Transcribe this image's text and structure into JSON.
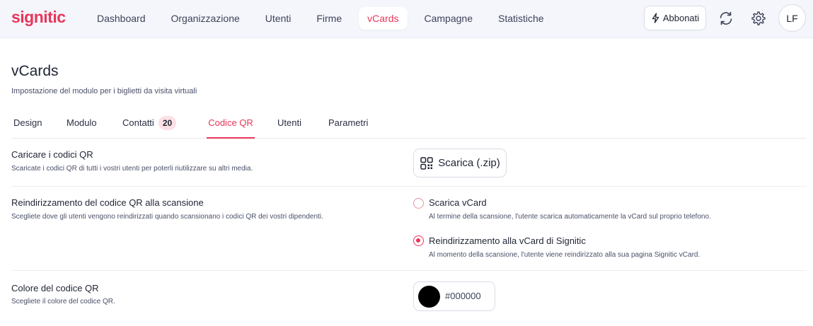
{
  "brand": {
    "name": "signitic",
    "accent": "#e8365a"
  },
  "nav": {
    "items": [
      {
        "label": "Dashboard",
        "active": false
      },
      {
        "label": "Organizzazione",
        "active": false
      },
      {
        "label": "Utenti",
        "active": false
      },
      {
        "label": "Firme",
        "active": false
      },
      {
        "label": "vCards",
        "active": true
      },
      {
        "label": "Campagne",
        "active": false
      },
      {
        "label": "Statistiche",
        "active": false
      }
    ],
    "subscribe_label": "Abbonati",
    "subscribe_icon": "lightning-icon",
    "sync_icon": "sync-icon",
    "settings_icon": "gear-icon",
    "avatar_initials": "LF"
  },
  "header": {
    "title": "vCards",
    "subtitle": "Impostazione del modulo per i biglietti da visita virtuali"
  },
  "tabs": [
    {
      "label": "Design",
      "active": false
    },
    {
      "label": "Modulo",
      "active": false
    },
    {
      "label": "Contatti",
      "badge": "20",
      "active": false
    },
    {
      "label": "Codice QR",
      "active": true
    },
    {
      "label": "Utenti",
      "active": false
    },
    {
      "label": "Parametri",
      "active": false
    }
  ],
  "sections": {
    "download": {
      "title": "Caricare i codici QR",
      "description": "Scaricate i codici QR di tutti i vostri utenti per poterli riutilizzare su altri media.",
      "button_label": "Scarica (.zip)",
      "button_icon": "qr-code-icon"
    },
    "redirect": {
      "title": "Reindirizzamento del codice QR alla scansione",
      "description": "Scegliete dove gli utenti vengono reindirizzati quando scansionano i codici QR dei vostri dipendenti.",
      "options": [
        {
          "label": "Scarica vCard",
          "description": "Al termine della scansione, l'utente scarica automaticamente la vCard sul proprio telefono.",
          "selected": false
        },
        {
          "label": "Reindirizzamento alla vCard di Signitic",
          "description": "Al momento della scansione, l'utente viene reindirizzato alla sua pagina Signitic vCard.",
          "selected": true
        }
      ]
    },
    "color": {
      "title": "Colore del codice QR",
      "description": "Scegliete il colore del codice QR.",
      "value": "#000000"
    }
  }
}
